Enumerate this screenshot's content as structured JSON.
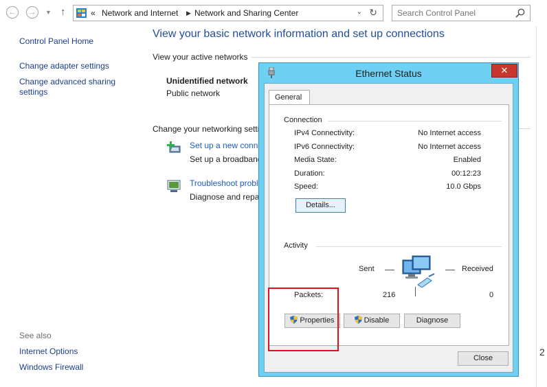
{
  "address_bar": {
    "chevron": "«",
    "crumbs": [
      "Network and Internet",
      "Network and Sharing Center"
    ],
    "search_placeholder": "Search Control Panel"
  },
  "left_nav": {
    "items": [
      "Control Panel Home",
      "Change adapter settings",
      "Change advanced sharing",
      "settings"
    ],
    "see_also_title": "See also",
    "see_also": [
      "Internet Options",
      "Windows Firewall"
    ]
  },
  "main": {
    "title": "View your basic network information and set up connections",
    "active_networks_label": "View your active networks",
    "network_name": "Unidentified network",
    "network_type": "Public network",
    "change_label": "Change your networking setti",
    "tasks": [
      {
        "link": "Set up a new conne",
        "desc": "Set up a broadband"
      },
      {
        "link": "Troubleshoot probl",
        "desc": "Diagnose and repai"
      }
    ]
  },
  "dialog": {
    "title": "Ethernet Status",
    "close_glyph": "✕",
    "tab": "General",
    "connection_label": "Connection",
    "rows": [
      {
        "label": "IPv4 Connectivity:",
        "value": "No Internet access"
      },
      {
        "label": "IPv6 Connectivity:",
        "value": "No Internet access"
      },
      {
        "label": "Media State:",
        "value": "Enabled"
      },
      {
        "label": "Duration:",
        "value": "00:12:23"
      },
      {
        "label": "Speed:",
        "value": "10.0 Gbps"
      }
    ],
    "details_button": "Details...",
    "activity_label": "Activity",
    "sent_label": "Sent",
    "received_label": "Received",
    "packets_label": "Packets:",
    "packets_sent": "216",
    "packets_received": "0",
    "properties_button": "Properties",
    "disable_button": "Disable",
    "diagnose_button": "Diagnose",
    "close_button": "Close"
  },
  "edge_text": "2",
  "colors": {
    "link": "#1c3e8c",
    "title_blue": "#1e4e9c",
    "dialog_frame": "#6ed0f2",
    "close_red": "#c8372d",
    "highlight_red": "#e0101a"
  }
}
